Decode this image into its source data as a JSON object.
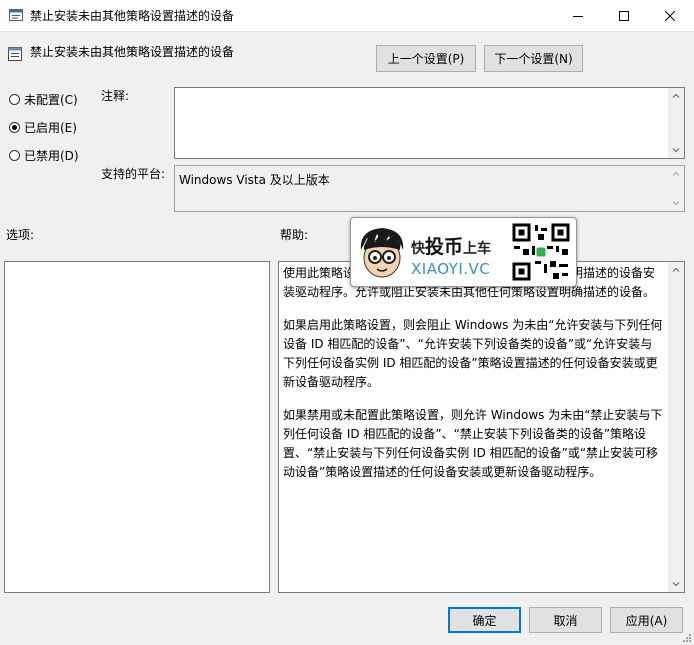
{
  "window": {
    "title": "禁止安装未由其他策略设置描述的设备"
  },
  "header": {
    "policy_name": "禁止安装未由其他策略设置描述的设备",
    "prev_label": "上一个设置(P)",
    "next_label": "下一个设置(N)"
  },
  "state": {
    "options": [
      {
        "label": "未配置(C)",
        "selected": false
      },
      {
        "label": "已启用(E)",
        "selected": true
      },
      {
        "label": "已禁用(D)",
        "selected": false
      }
    ]
  },
  "comment": {
    "label": "注释:",
    "value": ""
  },
  "platform": {
    "label": "支持的平台:",
    "value": "Windows Vista 及以上版本"
  },
  "options_panel": {
    "label": "选项:"
  },
  "help_panel": {
    "label": "帮助:",
    "paragraphs": [
      "使用此策略设置，可以阻止为未由其他策略设置特别说明描述的设备安装驱动程序。允许或阻止安装未由其他任何策略设置明确描述的设备。",
      "如果启用此策略设置，则会阻止 Windows 为未由“允许安装与下列任何设备 ID 相匹配的设备”、“允许安装下列设备类的设备”或“允许安装与下列任何设备实例 ID 相匹配的设备”策略设置描述的任何设备安装或更新设备驱动程序。",
      "如果禁用或未配置此策略设置，则允许 Windows 为未由“禁止安装与下列任何设备 ID 相匹配的设备”、“禁止安装下列设备类的设备”策略设置、“禁止安装与下列任何设备实例 ID 相匹配的设备”或“禁止安装可移动设备”策略设置描述的任何设备安装或更新设备驱动程序。"
    ]
  },
  "watermark": {
    "brand_cn_1": "快",
    "brand_cn_2": "投币",
    "brand_cn_3": "上车",
    "brand_en": "XIAOYI.VC"
  },
  "footer": {
    "ok_label": "确定",
    "cancel_label": "取消",
    "apply_label": "应用(A)"
  }
}
